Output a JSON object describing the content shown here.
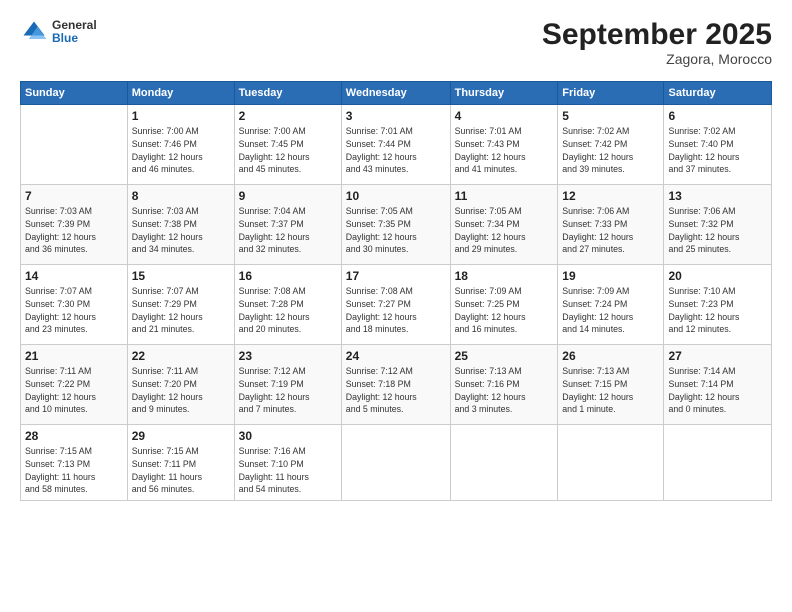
{
  "header": {
    "logo_general": "General",
    "logo_blue": "Blue",
    "month_title": "September 2025",
    "location": "Zagora, Morocco"
  },
  "days_of_week": [
    "Sunday",
    "Monday",
    "Tuesday",
    "Wednesday",
    "Thursday",
    "Friday",
    "Saturday"
  ],
  "weeks": [
    [
      {
        "day": "",
        "info": ""
      },
      {
        "day": "1",
        "info": "Sunrise: 7:00 AM\nSunset: 7:46 PM\nDaylight: 12 hours\nand 46 minutes."
      },
      {
        "day": "2",
        "info": "Sunrise: 7:00 AM\nSunset: 7:45 PM\nDaylight: 12 hours\nand 45 minutes."
      },
      {
        "day": "3",
        "info": "Sunrise: 7:01 AM\nSunset: 7:44 PM\nDaylight: 12 hours\nand 43 minutes."
      },
      {
        "day": "4",
        "info": "Sunrise: 7:01 AM\nSunset: 7:43 PM\nDaylight: 12 hours\nand 41 minutes."
      },
      {
        "day": "5",
        "info": "Sunrise: 7:02 AM\nSunset: 7:42 PM\nDaylight: 12 hours\nand 39 minutes."
      },
      {
        "day": "6",
        "info": "Sunrise: 7:02 AM\nSunset: 7:40 PM\nDaylight: 12 hours\nand 37 minutes."
      }
    ],
    [
      {
        "day": "7",
        "info": "Sunrise: 7:03 AM\nSunset: 7:39 PM\nDaylight: 12 hours\nand 36 minutes."
      },
      {
        "day": "8",
        "info": "Sunrise: 7:03 AM\nSunset: 7:38 PM\nDaylight: 12 hours\nand 34 minutes."
      },
      {
        "day": "9",
        "info": "Sunrise: 7:04 AM\nSunset: 7:37 PM\nDaylight: 12 hours\nand 32 minutes."
      },
      {
        "day": "10",
        "info": "Sunrise: 7:05 AM\nSunset: 7:35 PM\nDaylight: 12 hours\nand 30 minutes."
      },
      {
        "day": "11",
        "info": "Sunrise: 7:05 AM\nSunset: 7:34 PM\nDaylight: 12 hours\nand 29 minutes."
      },
      {
        "day": "12",
        "info": "Sunrise: 7:06 AM\nSunset: 7:33 PM\nDaylight: 12 hours\nand 27 minutes."
      },
      {
        "day": "13",
        "info": "Sunrise: 7:06 AM\nSunset: 7:32 PM\nDaylight: 12 hours\nand 25 minutes."
      }
    ],
    [
      {
        "day": "14",
        "info": "Sunrise: 7:07 AM\nSunset: 7:30 PM\nDaylight: 12 hours\nand 23 minutes."
      },
      {
        "day": "15",
        "info": "Sunrise: 7:07 AM\nSunset: 7:29 PM\nDaylight: 12 hours\nand 21 minutes."
      },
      {
        "day": "16",
        "info": "Sunrise: 7:08 AM\nSunset: 7:28 PM\nDaylight: 12 hours\nand 20 minutes."
      },
      {
        "day": "17",
        "info": "Sunrise: 7:08 AM\nSunset: 7:27 PM\nDaylight: 12 hours\nand 18 minutes."
      },
      {
        "day": "18",
        "info": "Sunrise: 7:09 AM\nSunset: 7:25 PM\nDaylight: 12 hours\nand 16 minutes."
      },
      {
        "day": "19",
        "info": "Sunrise: 7:09 AM\nSunset: 7:24 PM\nDaylight: 12 hours\nand 14 minutes."
      },
      {
        "day": "20",
        "info": "Sunrise: 7:10 AM\nSunset: 7:23 PM\nDaylight: 12 hours\nand 12 minutes."
      }
    ],
    [
      {
        "day": "21",
        "info": "Sunrise: 7:11 AM\nSunset: 7:22 PM\nDaylight: 12 hours\nand 10 minutes."
      },
      {
        "day": "22",
        "info": "Sunrise: 7:11 AM\nSunset: 7:20 PM\nDaylight: 12 hours\nand 9 minutes."
      },
      {
        "day": "23",
        "info": "Sunrise: 7:12 AM\nSunset: 7:19 PM\nDaylight: 12 hours\nand 7 minutes."
      },
      {
        "day": "24",
        "info": "Sunrise: 7:12 AM\nSunset: 7:18 PM\nDaylight: 12 hours\nand 5 minutes."
      },
      {
        "day": "25",
        "info": "Sunrise: 7:13 AM\nSunset: 7:16 PM\nDaylight: 12 hours\nand 3 minutes."
      },
      {
        "day": "26",
        "info": "Sunrise: 7:13 AM\nSunset: 7:15 PM\nDaylight: 12 hours\nand 1 minute."
      },
      {
        "day": "27",
        "info": "Sunrise: 7:14 AM\nSunset: 7:14 PM\nDaylight: 12 hours\nand 0 minutes."
      }
    ],
    [
      {
        "day": "28",
        "info": "Sunrise: 7:15 AM\nSunset: 7:13 PM\nDaylight: 11 hours\nand 58 minutes."
      },
      {
        "day": "29",
        "info": "Sunrise: 7:15 AM\nSunset: 7:11 PM\nDaylight: 11 hours\nand 56 minutes."
      },
      {
        "day": "30",
        "info": "Sunrise: 7:16 AM\nSunset: 7:10 PM\nDaylight: 11 hours\nand 54 minutes."
      },
      {
        "day": "",
        "info": ""
      },
      {
        "day": "",
        "info": ""
      },
      {
        "day": "",
        "info": ""
      },
      {
        "day": "",
        "info": ""
      }
    ]
  ]
}
